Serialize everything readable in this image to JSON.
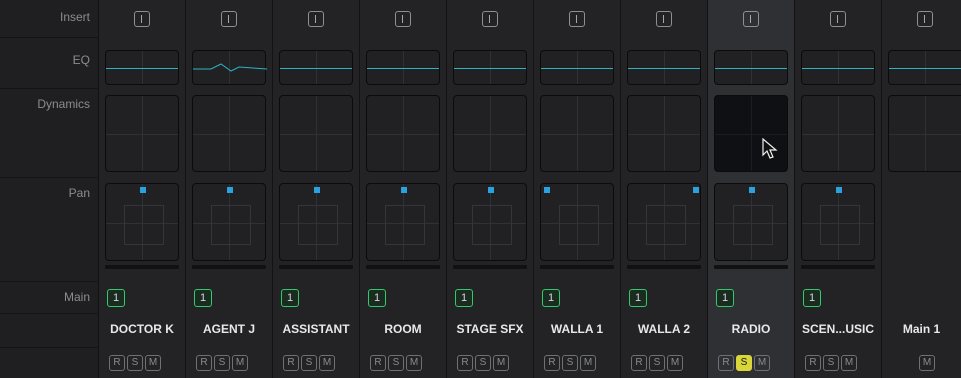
{
  "labels": {
    "insert": "Insert",
    "eq": "EQ",
    "dynamics": "Dynamics",
    "pan": "Pan",
    "main": "Main"
  },
  "tracks": [
    {
      "name": "DOCTOR K",
      "main": "1",
      "rsm": [
        "R",
        "S",
        "M"
      ]
    },
    {
      "name": "AGENT J",
      "main": "1",
      "rsm": [
        "R",
        "S",
        "M"
      ]
    },
    {
      "name": "ASSISTANT",
      "main": "1",
      "rsm": [
        "R",
        "S",
        "M"
      ]
    },
    {
      "name": "ROOM",
      "main": "1",
      "rsm": [
        "R",
        "S",
        "M"
      ]
    },
    {
      "name": "STAGE SFX",
      "main": "1",
      "rsm": [
        "R",
        "S",
        "M"
      ]
    },
    {
      "name": "WALLA 1",
      "main": "1",
      "rsm": [
        "R",
        "S",
        "M"
      ]
    },
    {
      "name": "WALLA 2",
      "main": "1",
      "rsm": [
        "R",
        "S",
        "M"
      ]
    },
    {
      "name": "RADIO",
      "main": "1",
      "rsm": [
        "R",
        "S",
        "M"
      ]
    },
    {
      "name": "SCEN...USIC",
      "main": "1",
      "rsm": [
        "R",
        "S",
        "M"
      ]
    },
    {
      "name": "Main 1",
      "main": "",
      "rsm": [
        "M"
      ]
    }
  ],
  "colors": {
    "eq_line": "#2bb3c4",
    "pan_dot": "#2aa2de",
    "main_green": "#34c86d",
    "solo_yellow": "#d9d63b",
    "highlight": "#2f3034"
  },
  "state": {
    "highlighted_track": "RADIO",
    "solo_active_track": "RADIO"
  }
}
